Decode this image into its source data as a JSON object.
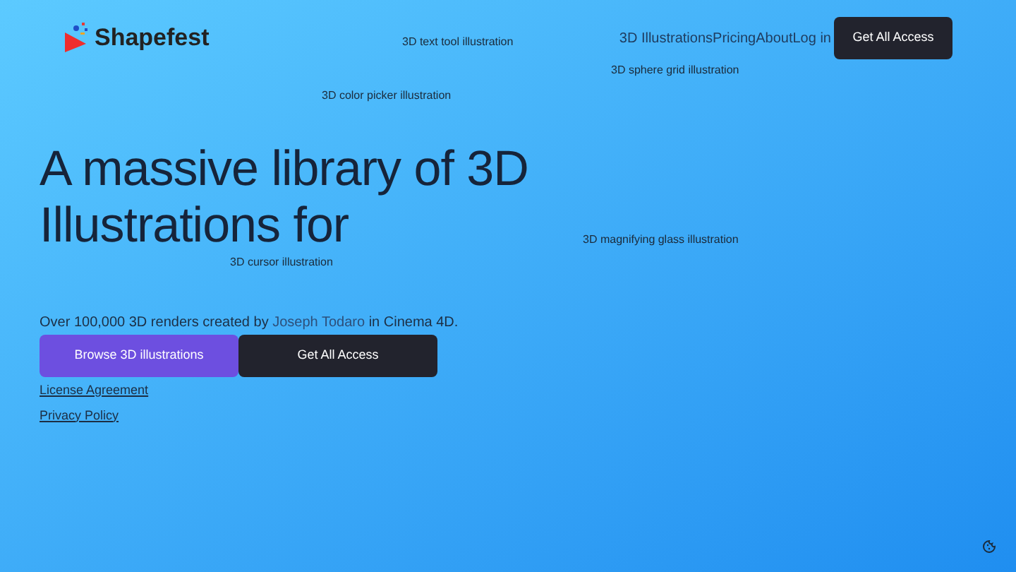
{
  "logo": {
    "text": "Shapefest"
  },
  "nav": {
    "links": [
      "3D Illustrations",
      "Pricing",
      "About",
      "Log in"
    ],
    "cta": "Get All Access"
  },
  "image_alts": [
    "3D text tool illustration",
    "3D sphere grid illustration",
    "3D color picker illustration",
    "3D cursor illustration",
    "3D magnifying glass illustration"
  ],
  "hero": {
    "heading": "A massive library of 3D Illustrations for",
    "description_before": "Over 100,000 3D renders created by",
    "author_link": "Joseph Todaro",
    "description_after": "in Cinema 4D.",
    "buttons": [
      {
        "label": "Browse 3D illustrations",
        "kind": "primary"
      },
      {
        "label": "Get All Access",
        "kind": "dark"
      }
    ],
    "links": [
      "License Agreement",
      "Privacy Policy"
    ]
  }
}
